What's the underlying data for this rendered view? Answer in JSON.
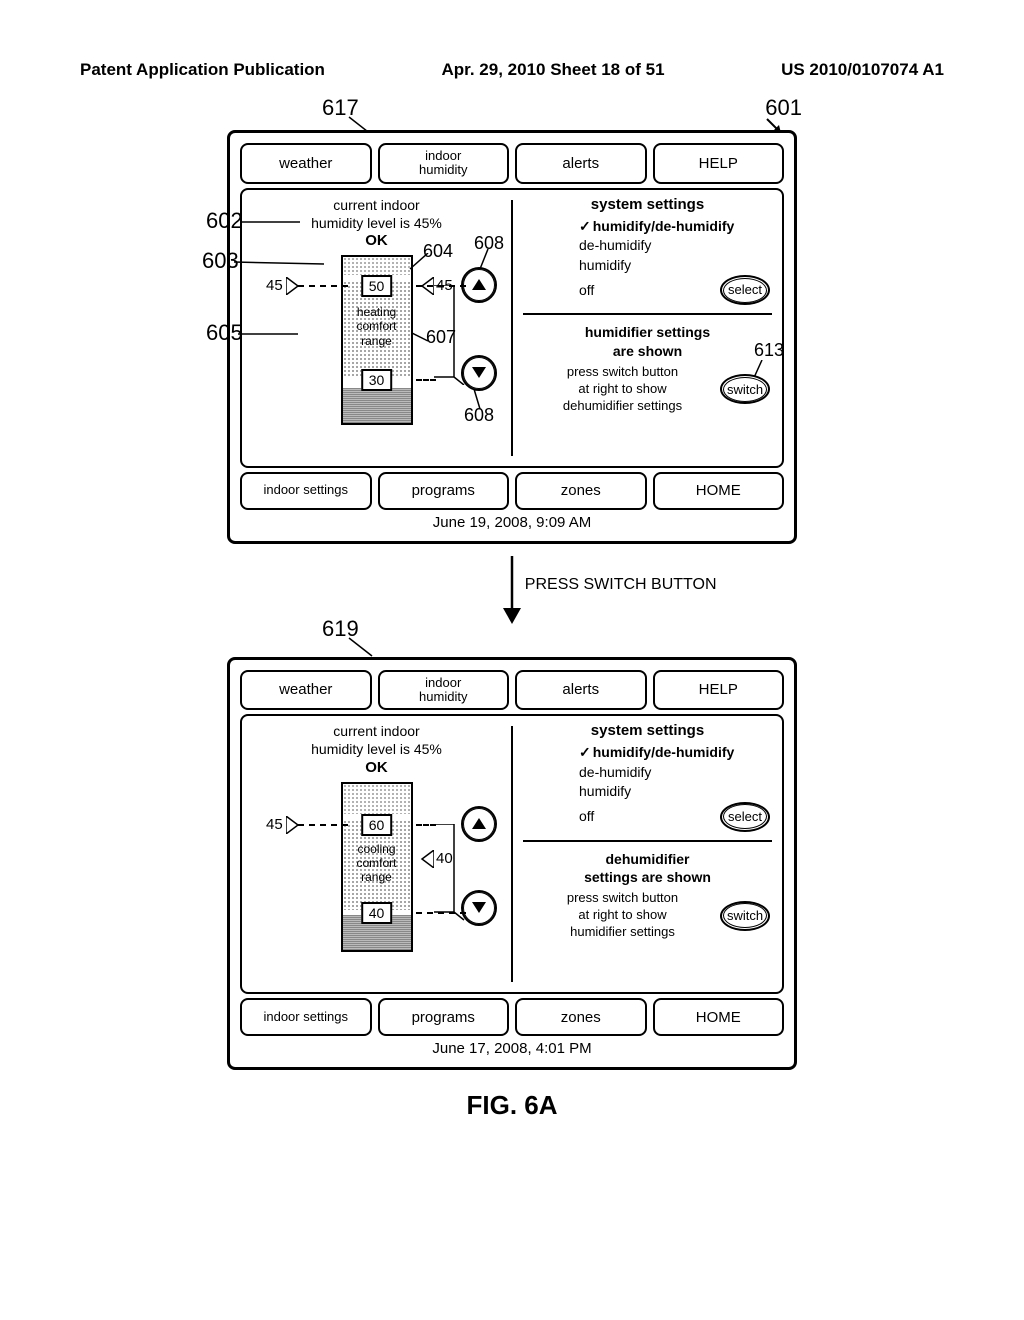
{
  "header": {
    "left": "Patent Application Publication",
    "center": "Apr. 29, 2010  Sheet 18 of 51",
    "right": "US 2010/0107074 A1"
  },
  "refs": {
    "r601": "601",
    "r617": "617",
    "r602": "602",
    "r603": "603",
    "r604": "604",
    "r605": "605",
    "r607": "607",
    "r608": "608",
    "r613": "613",
    "r619": "619"
  },
  "tabs": {
    "weather": "weather",
    "indoor": "indoor\nhumidity",
    "alerts": "alerts",
    "help": "HELP",
    "indoor_settings": "indoor settings",
    "programs": "programs",
    "zones": "zones",
    "home": "HOME"
  },
  "screen1": {
    "status1": "current indoor",
    "status2": "humidity level is 45%",
    "ok": "OK",
    "left_val": "45",
    "top_box": "50",
    "right_val": "45",
    "mid_text": "heating\ncomfort\nrange",
    "bot_box": "30",
    "sys_title": "system settings",
    "opt1": "humidify/de-humidify",
    "opt2": "de-humidify",
    "opt3": "humidify",
    "opt4": "off",
    "select": "select",
    "sub_title": "humidifier settings\nare shown",
    "sub_text": "press switch button\nat right to show\ndehumidifier settings",
    "switch": "switch",
    "datetime": "June 19, 2008, 9:09 AM"
  },
  "flow_label": "PRESS SWITCH BUTTON",
  "screen2": {
    "status1": "current indoor",
    "status2": "humidity level is 45%",
    "ok": "OK",
    "left_val": "45",
    "top_box": "60",
    "right_val": "40",
    "mid_text": "cooling\ncomfort\nrange",
    "bot_box": "40",
    "sys_title": "system settings",
    "opt1": "humidify/de-humidify",
    "opt2": "de-humidify",
    "opt3": "humidify",
    "opt4": "off",
    "select": "select",
    "sub_title": "dehumidifier\nsettings are shown",
    "sub_text": "press switch button\nat right to show\nhumidifier settings",
    "switch": "switch",
    "datetime": "June 17, 2008, 4:01 PM"
  },
  "figure_label": "FIG. 6A"
}
